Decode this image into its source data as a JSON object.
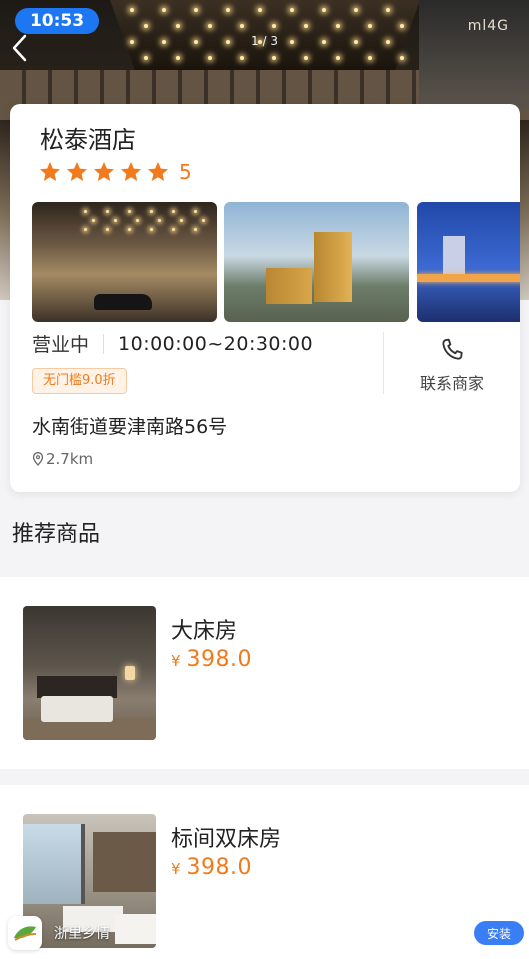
{
  "status_bar": {
    "time": "10:53"
  },
  "hero": {
    "page_indicator": "1 / 3",
    "sign_text": "ml4G"
  },
  "hotel": {
    "name": "松泰酒店",
    "rating_value": "5",
    "stars": 5,
    "status": "营业中",
    "hours": "10:00:00~20:30:00",
    "discount": "无门槛9.0折",
    "contact_label": "联系商家",
    "address": "水南街道要津南路56号",
    "distance": "2.7km"
  },
  "section": {
    "title": "推荐商品"
  },
  "products": [
    {
      "name": "大床房",
      "currency": "¥",
      "price": "398.0"
    },
    {
      "name": "标间双床房",
      "currency": "¥",
      "price": "398.0"
    }
  ],
  "footer": {
    "brand_name": "浙里乡情",
    "install_label": "安装"
  },
  "colors": {
    "accent_orange": "#f07a1c",
    "time_pill": "#1d77f2",
    "install_button": "#3a7ef5"
  },
  "icons": {
    "back": "chevron-left-icon",
    "star": "star-icon",
    "phone": "phone-icon",
    "location": "location-pin-icon"
  }
}
